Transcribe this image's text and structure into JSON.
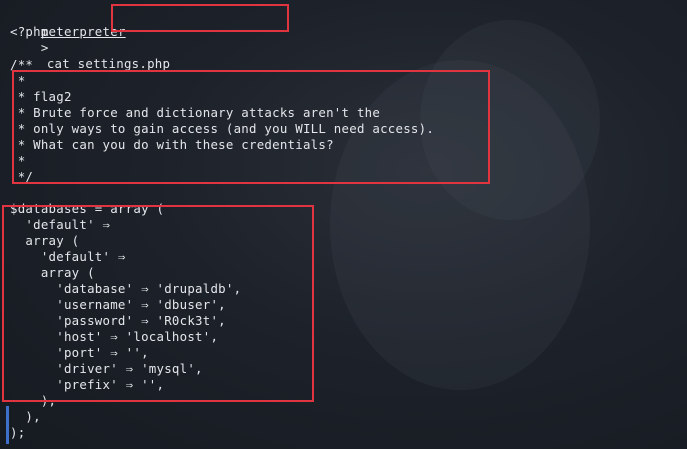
{
  "prompt": {
    "name": "meterpreter",
    "separator": ">",
    "command": "cat settings.php"
  },
  "output_lines": [
    "<?php",
    "",
    "/**",
    " *",
    " * flag2",
    " * Brute force and dictionary attacks aren't the",
    " * only ways to gain access (and you WILL need access).",
    " * What can you do with these credentials?",
    " *",
    " */",
    "",
    "$databases = array (",
    "  'default' ⇒",
    "  array (",
    "    'default' ⇒",
    "    array (",
    "      'database' ⇒ 'drupaldb',",
    "      'username' ⇒ 'dbuser',",
    "      'password' ⇒ 'R0ck3t',",
    "      'host' ⇒ 'localhost',",
    "      'port' ⇒ '',",
    "      'driver' ⇒ 'mysql',",
    "      'prefix' ⇒ '',",
    "    ),",
    "  ),",
    ");"
  ],
  "highlight_color": "#e03440"
}
